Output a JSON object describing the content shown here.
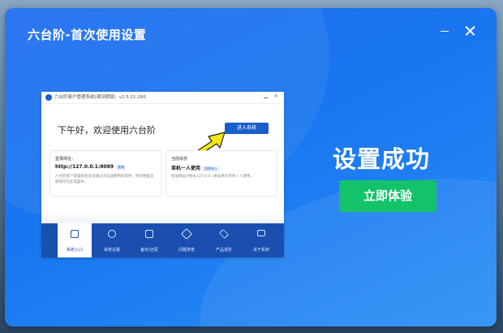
{
  "window": {
    "title": "六台阶-首次使用设置"
  },
  "preview": {
    "app_title": "六台阶客户管理系统(课设期版)",
    "version": "v2.5.21.266",
    "greeting": "下午好，欢迎使用六台阶",
    "enter_button": "进入系统",
    "card_login": {
      "label": "登录网址：",
      "value": "http://127.0.0.1:8089",
      "tag": "复制",
      "desc": "六台阶客户管理系统支持通过浏览器使用的软件，所有数据全部保存在此电脑中。"
    },
    "card_status": {
      "label": "当前状态",
      "value": "单机一人使用",
      "tag": "切换多人",
      "desc": "登录网址IP地址127.0.0.1要该者仅单机一人使用。"
    },
    "nav": [
      {
        "label": "系统入口",
        "icon": "door-icon",
        "active": true
      },
      {
        "label": "系统设置",
        "icon": "gear-icon"
      },
      {
        "label": "备份/还原",
        "icon": "backup-icon"
      },
      {
        "label": "问题排查",
        "icon": "wrench-icon"
      },
      {
        "label": "产品进阶",
        "icon": "layers-icon"
      },
      {
        "label": "关于系统",
        "icon": "monitor-icon"
      }
    ]
  },
  "status": {
    "success_text": "设置成功"
  },
  "actions": {
    "try_now": "立即体验"
  },
  "colors": {
    "window_blue": "#1f6ef0",
    "button_green": "#14c26a",
    "nav_blue": "#1a4fb0"
  }
}
